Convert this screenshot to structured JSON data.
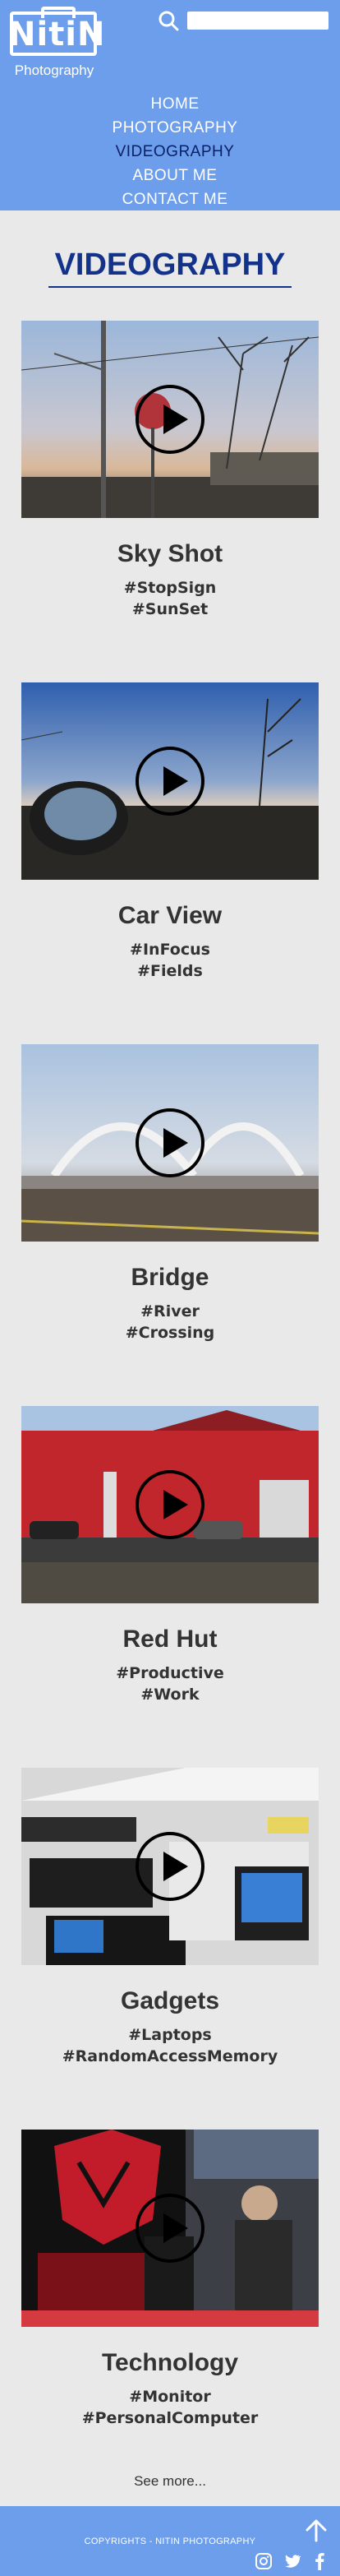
{
  "brand": {
    "name": "NitiN",
    "tagline": "Photography"
  },
  "search": {
    "placeholder": ""
  },
  "nav": {
    "items": [
      "HOME",
      "PHOTOGRAPHY",
      "VIDEOGRAPHY",
      "ABOUT ME",
      "CONTACT ME"
    ],
    "active_index": 2
  },
  "page": {
    "title": "VIDEOGRAPHY"
  },
  "videos": [
    {
      "title": "Sky Shot",
      "tags": [
        "#StopSign",
        "#SunSet"
      ]
    },
    {
      "title": "Car View",
      "tags": [
        "#InFocus",
        "#Fields"
      ]
    },
    {
      "title": "Bridge",
      "tags": [
        "#River",
        "#Crossing"
      ]
    },
    {
      "title": "Red Hut",
      "tags": [
        "#Productive",
        "#Work"
      ]
    },
    {
      "title": "Gadgets",
      "tags": [
        "#Laptops",
        "#RandomAccessMemory"
      ]
    },
    {
      "title": "Technology",
      "tags": [
        "#Monitor",
        "#PersonalComputer"
      ]
    }
  ],
  "see_more": "See more...",
  "footer": {
    "copyright": "COPYRIGHTS - NITIN PHOTOGRAPHY"
  },
  "icons": {
    "search": "search-icon",
    "play": "play-icon",
    "to_top": "arrow-up-icon",
    "social": [
      "instagram-icon",
      "twitter-icon",
      "facebook-icon"
    ]
  },
  "colors": {
    "header_bg": "#6d9eeb",
    "title": "#13338a",
    "active_nav": "#0b1f66",
    "page_bg": "#e9e9e9"
  }
}
